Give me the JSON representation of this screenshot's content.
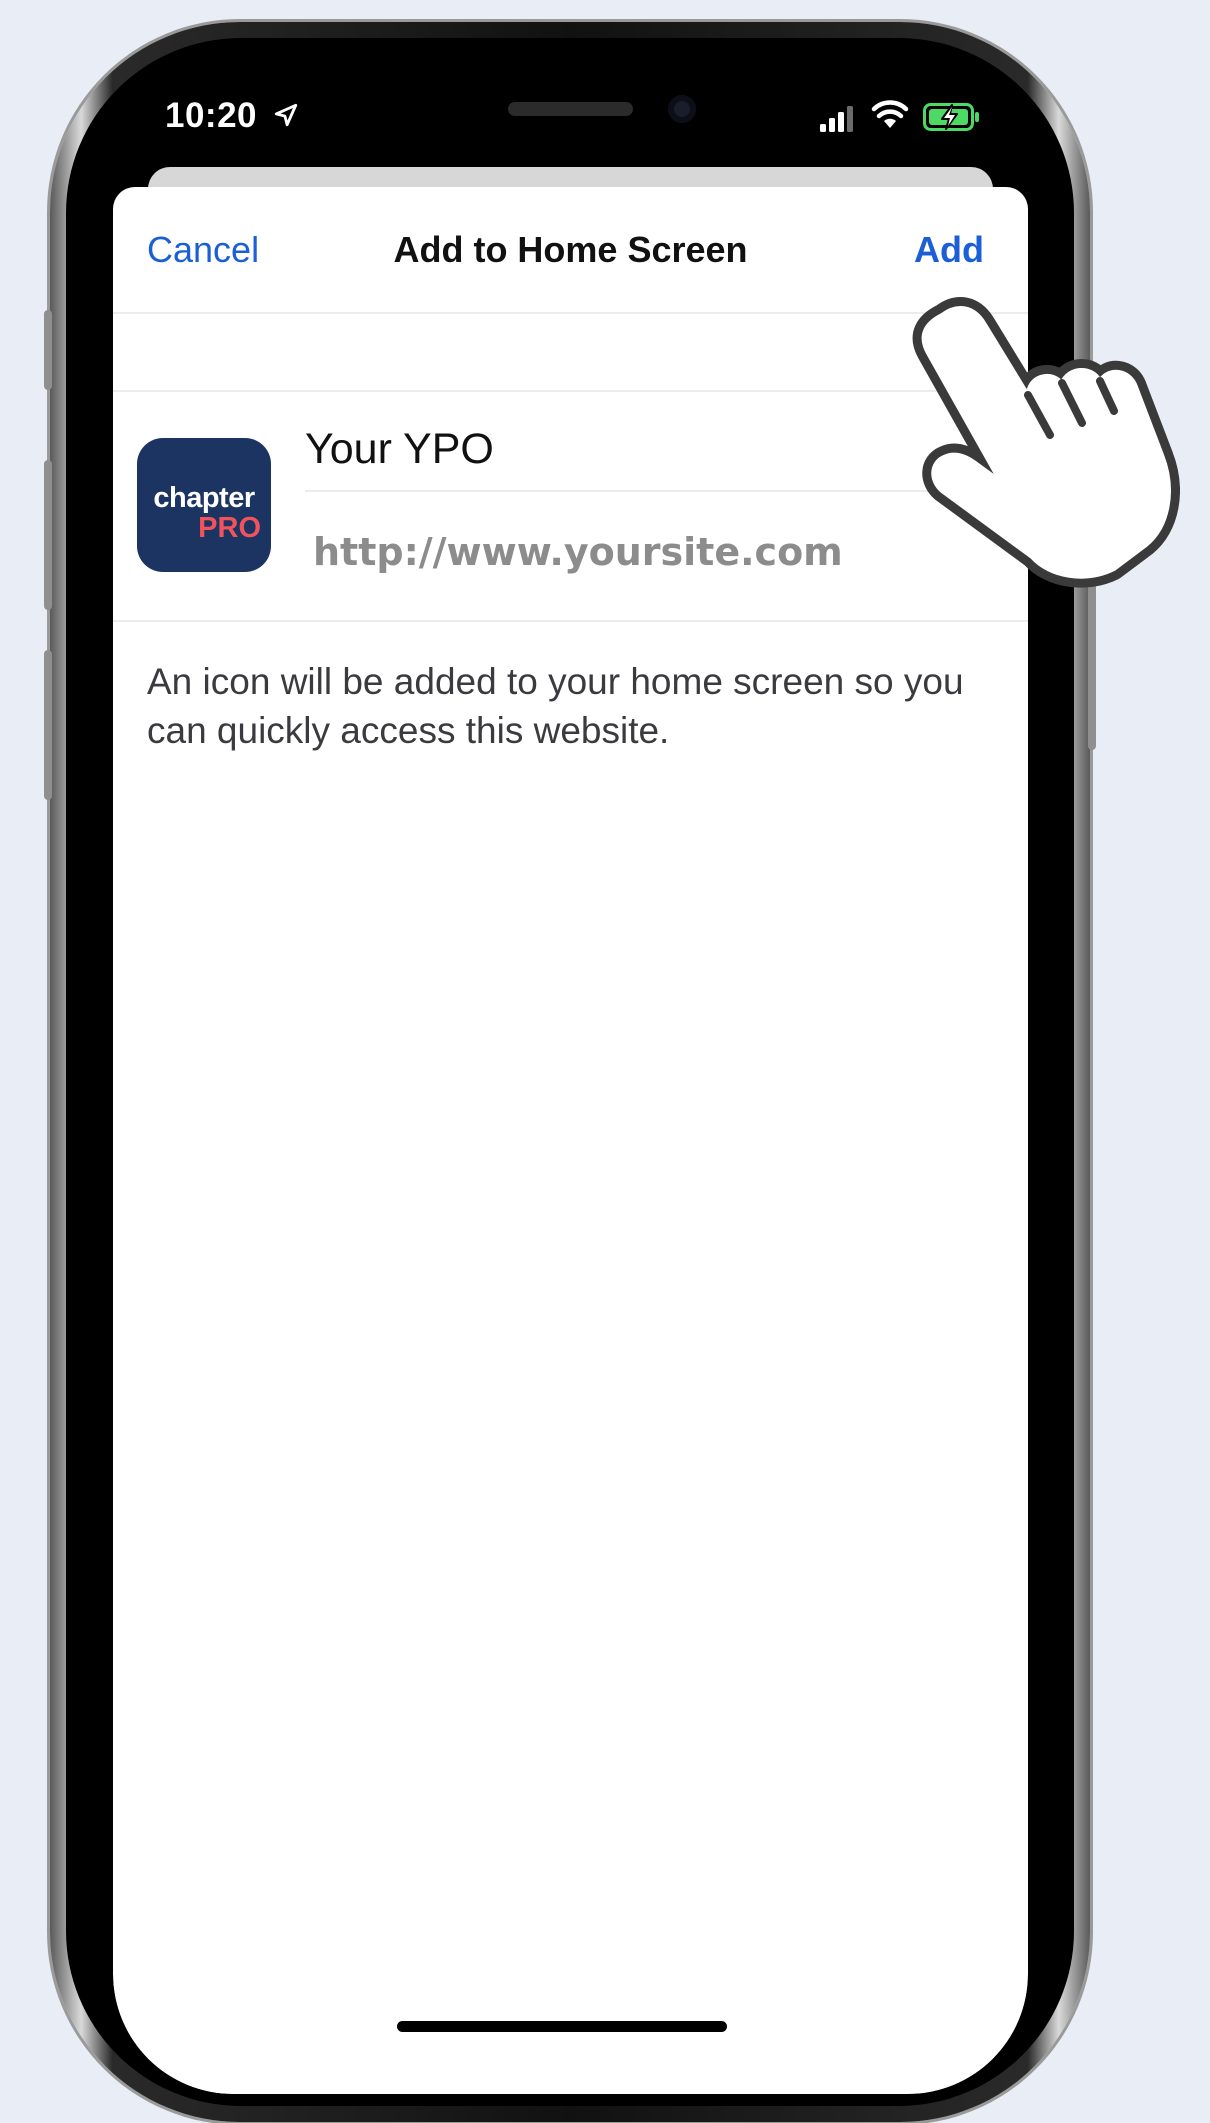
{
  "status_bar": {
    "time": "10:20"
  },
  "nav": {
    "cancel_label": "Cancel",
    "title": "Add to Home Screen",
    "add_label": "Add"
  },
  "app": {
    "icon_text_top": "chapter",
    "icon_text_bottom": "PRO",
    "name_value": "Your YPO",
    "url": "http://www.yoursite.com"
  },
  "description": "An icon will be added to your home screen so you can quickly access this website.",
  "colors": {
    "accent": "#1a5fd6",
    "icon_bg": "#1c3461",
    "icon_pro": "#f1535d",
    "battery": "#4cd964"
  },
  "icons": [
    "location-arrow-icon",
    "signal-icon",
    "wifi-icon",
    "battery-charging-icon",
    "hand-pointer-icon"
  ]
}
